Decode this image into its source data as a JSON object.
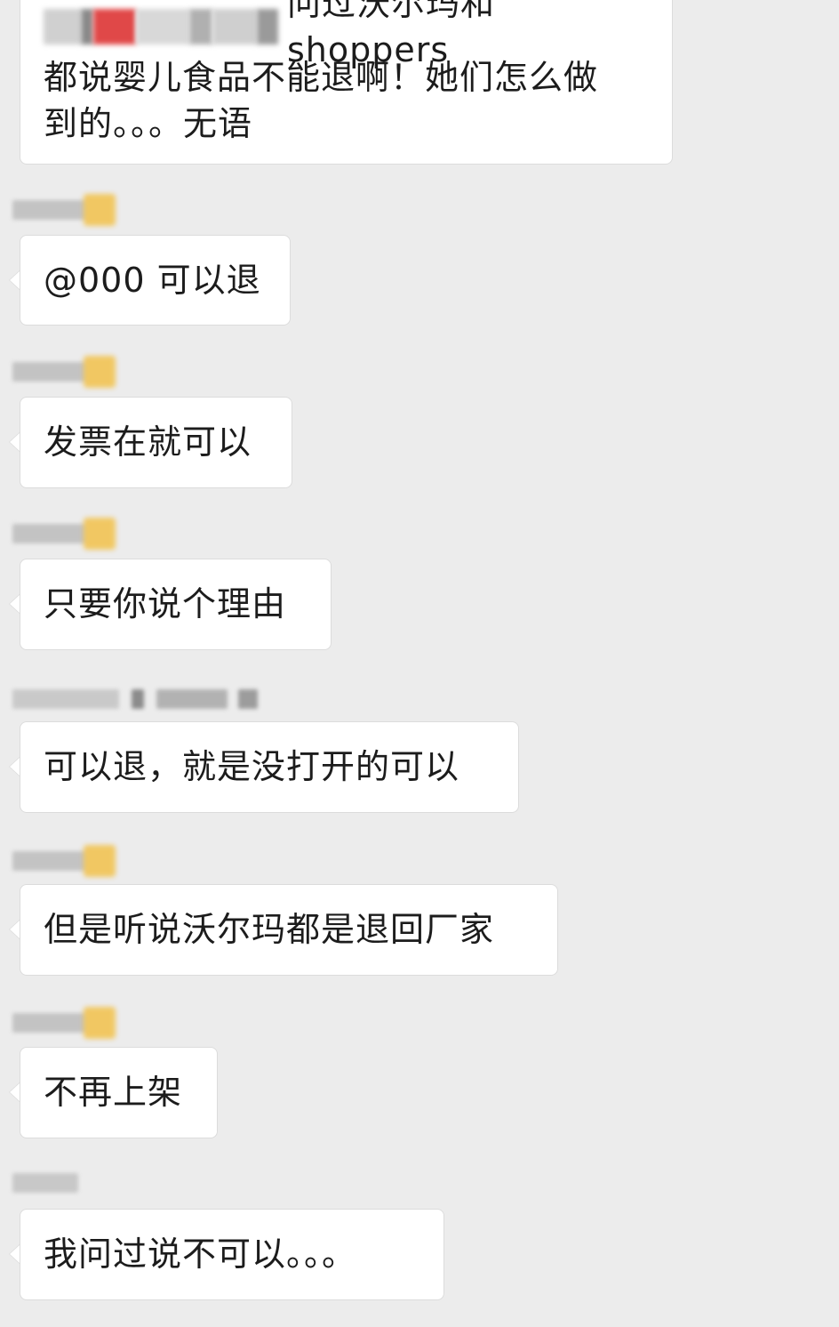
{
  "messages": [
    {
      "id": "m1",
      "text_line1": "问过沃尔玛和shoppers",
      "text_line2": "都说婴儿食品不能退啊！她们怎么做",
      "text_line3": "到的。。。无语"
    },
    {
      "id": "m2",
      "text": "@000 可以退"
    },
    {
      "id": "m3",
      "text": "发票在就可以"
    },
    {
      "id": "m4",
      "text": "只要你说个理由"
    },
    {
      "id": "m5",
      "text": "可以退，就是没打开的可以"
    },
    {
      "id": "m6",
      "text": "但是听说沃尔玛都是退回厂家"
    },
    {
      "id": "m7",
      "text": "不再上架"
    },
    {
      "id": "m8",
      "text": "我问过说不可以。。。"
    }
  ],
  "colors": {
    "background": "#ececec",
    "bubble": "#ffffff",
    "text": "#1c1c1c",
    "blurred_name": "#b8b8b8",
    "blurred_emoji": "#f2c454"
  }
}
